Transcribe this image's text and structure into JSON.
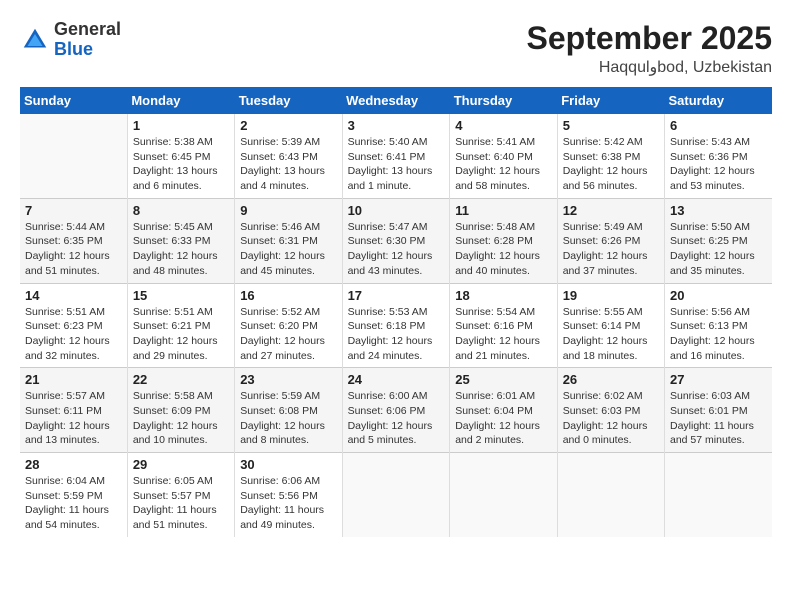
{
  "header": {
    "logo_general": "General",
    "logo_blue": "Blue",
    "title": "September 2025",
    "subtitle": "Haqqulوbod, Uzbekistan"
  },
  "days_of_week": [
    "Sunday",
    "Monday",
    "Tuesday",
    "Wednesday",
    "Thursday",
    "Friday",
    "Saturday"
  ],
  "weeks": [
    [
      {
        "day": "",
        "info": ""
      },
      {
        "day": "1",
        "info": "Sunrise: 5:38 AM\nSunset: 6:45 PM\nDaylight: 13 hours\nand 6 minutes."
      },
      {
        "day": "2",
        "info": "Sunrise: 5:39 AM\nSunset: 6:43 PM\nDaylight: 13 hours\nand 4 minutes."
      },
      {
        "day": "3",
        "info": "Sunrise: 5:40 AM\nSunset: 6:41 PM\nDaylight: 13 hours\nand 1 minute."
      },
      {
        "day": "4",
        "info": "Sunrise: 5:41 AM\nSunset: 6:40 PM\nDaylight: 12 hours\nand 58 minutes."
      },
      {
        "day": "5",
        "info": "Sunrise: 5:42 AM\nSunset: 6:38 PM\nDaylight: 12 hours\nand 56 minutes."
      },
      {
        "day": "6",
        "info": "Sunrise: 5:43 AM\nSunset: 6:36 PM\nDaylight: 12 hours\nand 53 minutes."
      }
    ],
    [
      {
        "day": "7",
        "info": "Sunrise: 5:44 AM\nSunset: 6:35 PM\nDaylight: 12 hours\nand 51 minutes."
      },
      {
        "day": "8",
        "info": "Sunrise: 5:45 AM\nSunset: 6:33 PM\nDaylight: 12 hours\nand 48 minutes."
      },
      {
        "day": "9",
        "info": "Sunrise: 5:46 AM\nSunset: 6:31 PM\nDaylight: 12 hours\nand 45 minutes."
      },
      {
        "day": "10",
        "info": "Sunrise: 5:47 AM\nSunset: 6:30 PM\nDaylight: 12 hours\nand 43 minutes."
      },
      {
        "day": "11",
        "info": "Sunrise: 5:48 AM\nSunset: 6:28 PM\nDaylight: 12 hours\nand 40 minutes."
      },
      {
        "day": "12",
        "info": "Sunrise: 5:49 AM\nSunset: 6:26 PM\nDaylight: 12 hours\nand 37 minutes."
      },
      {
        "day": "13",
        "info": "Sunrise: 5:50 AM\nSunset: 6:25 PM\nDaylight: 12 hours\nand 35 minutes."
      }
    ],
    [
      {
        "day": "14",
        "info": "Sunrise: 5:51 AM\nSunset: 6:23 PM\nDaylight: 12 hours\nand 32 minutes."
      },
      {
        "day": "15",
        "info": "Sunrise: 5:51 AM\nSunset: 6:21 PM\nDaylight: 12 hours\nand 29 minutes."
      },
      {
        "day": "16",
        "info": "Sunrise: 5:52 AM\nSunset: 6:20 PM\nDaylight: 12 hours\nand 27 minutes."
      },
      {
        "day": "17",
        "info": "Sunrise: 5:53 AM\nSunset: 6:18 PM\nDaylight: 12 hours\nand 24 minutes."
      },
      {
        "day": "18",
        "info": "Sunrise: 5:54 AM\nSunset: 6:16 PM\nDaylight: 12 hours\nand 21 minutes."
      },
      {
        "day": "19",
        "info": "Sunrise: 5:55 AM\nSunset: 6:14 PM\nDaylight: 12 hours\nand 18 minutes."
      },
      {
        "day": "20",
        "info": "Sunrise: 5:56 AM\nSunset: 6:13 PM\nDaylight: 12 hours\nand 16 minutes."
      }
    ],
    [
      {
        "day": "21",
        "info": "Sunrise: 5:57 AM\nSunset: 6:11 PM\nDaylight: 12 hours\nand 13 minutes."
      },
      {
        "day": "22",
        "info": "Sunrise: 5:58 AM\nSunset: 6:09 PM\nDaylight: 12 hours\nand 10 minutes."
      },
      {
        "day": "23",
        "info": "Sunrise: 5:59 AM\nSunset: 6:08 PM\nDaylight: 12 hours\nand 8 minutes."
      },
      {
        "day": "24",
        "info": "Sunrise: 6:00 AM\nSunset: 6:06 PM\nDaylight: 12 hours\nand 5 minutes."
      },
      {
        "day": "25",
        "info": "Sunrise: 6:01 AM\nSunset: 6:04 PM\nDaylight: 12 hours\nand 2 minutes."
      },
      {
        "day": "26",
        "info": "Sunrise: 6:02 AM\nSunset: 6:03 PM\nDaylight: 12 hours\nand 0 minutes."
      },
      {
        "day": "27",
        "info": "Sunrise: 6:03 AM\nSunset: 6:01 PM\nDaylight: 11 hours\nand 57 minutes."
      }
    ],
    [
      {
        "day": "28",
        "info": "Sunrise: 6:04 AM\nSunset: 5:59 PM\nDaylight: 11 hours\nand 54 minutes."
      },
      {
        "day": "29",
        "info": "Sunrise: 6:05 AM\nSunset: 5:57 PM\nDaylight: 11 hours\nand 51 minutes."
      },
      {
        "day": "30",
        "info": "Sunrise: 6:06 AM\nSunset: 5:56 PM\nDaylight: 11 hours\nand 49 minutes."
      },
      {
        "day": "",
        "info": ""
      },
      {
        "day": "",
        "info": ""
      },
      {
        "day": "",
        "info": ""
      },
      {
        "day": "",
        "info": ""
      }
    ]
  ]
}
